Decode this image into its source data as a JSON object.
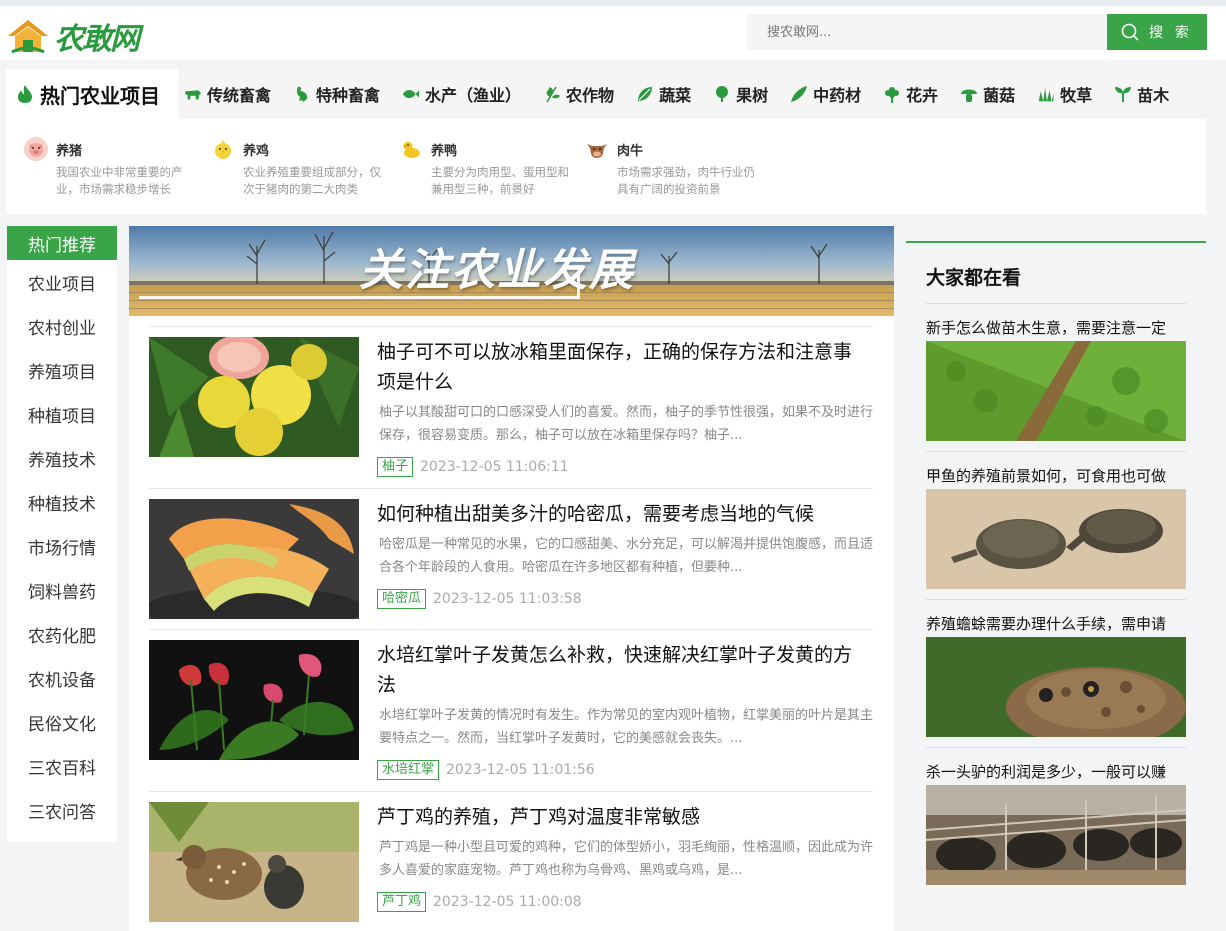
{
  "header": {
    "logo_text": "农敢网",
    "search_placeholder": "搜农敢网...",
    "search_button": "搜 索"
  },
  "categories": {
    "active": "热门农业项目",
    "items": [
      {
        "label": "传统畜禽",
        "icon": "cow-icon"
      },
      {
        "label": "特种畜禽",
        "icon": "rooster-icon"
      },
      {
        "label": "水产（渔业）",
        "icon": "fish-icon"
      },
      {
        "label": "农作物",
        "icon": "wheat-icon"
      },
      {
        "label": "蔬菜",
        "icon": "vegetable-icon"
      },
      {
        "label": "果树",
        "icon": "fruit-tree-icon"
      },
      {
        "label": "中药材",
        "icon": "herb-leaf-icon"
      },
      {
        "label": "花卉",
        "icon": "flower-icon"
      },
      {
        "label": "菌菇",
        "icon": "mushroom-icon"
      },
      {
        "label": "牧草",
        "icon": "grass-icon"
      },
      {
        "label": "苗木",
        "icon": "sapling-icon"
      }
    ]
  },
  "subpanel": [
    {
      "title": "养猪",
      "icon": "pig-icon",
      "desc": "我国农业中非常重要的产业，市场需求稳步增长"
    },
    {
      "title": "养鸡",
      "icon": "chick-icon",
      "desc": "农业养殖重要组成部分，仅次于猪肉的第二大肉类"
    },
    {
      "title": "养鸭",
      "icon": "duck-icon",
      "desc": "主要分为肉用型、蛋用型和兼用型三种，前景好"
    },
    {
      "title": "肉牛",
      "icon": "cattle-icon",
      "desc": "市场需求强劲，肉牛行业仍具有广阔的投资前景"
    }
  ],
  "leftnav": {
    "head": "热门推荐",
    "items": [
      "农业项目",
      "农村创业",
      "养殖项目",
      "种植项目",
      "养殖技术",
      "种植技术",
      "市场行情",
      "饲料兽药",
      "农药化肥",
      "农机设备",
      "民俗文化",
      "三农百科",
      "三农问答"
    ]
  },
  "banner": {
    "text": "关注农业发展"
  },
  "articles": [
    {
      "title": "柚子可不可以放冰箱里面保存，正确的保存方法和注意事项是什么",
      "desc": "柚子以其酸甜可口的口感深受人们的喜爱。然而，柚子的季节性很强，如果不及时进行保存，很容易变质。那么，柚子可以放在冰箱里保存吗？柚子...",
      "tag": "柚子",
      "date": "2023-12-05 11:06:11"
    },
    {
      "title": "如何种植出甜美多汁的哈密瓜，需要考虑当地的气候",
      "desc": "哈密瓜是一种常见的水果，它的口感甜美、水分充足，可以解渴并提供饱腹感，而且适合各个年龄段的人食用。哈密瓜在许多地区都有种植，但要种...",
      "tag": "哈密瓜",
      "date": "2023-12-05 11:03:58"
    },
    {
      "title": "水培红掌叶子发黄怎么补救，快速解决红掌叶子发黄的方法",
      "desc": "水培红掌叶子发黄的情况时有发生。作为常见的室内观叶植物，红掌美丽的叶片是其主要特点之一。然而，当红掌叶子发黄时，它的美感就会丧失。...",
      "tag": "水培红掌",
      "date": "2023-12-05 11:01:56"
    },
    {
      "title": "芦丁鸡的养殖，芦丁鸡对温度非常敏感",
      "desc": "芦丁鸡是一种小型且可爱的鸡种，它们的体型娇小，羽毛绚丽，性格温顺，因此成为许多人喜爱的家庭宠物。芦丁鸡也称为乌骨鸡、黑鸡或乌鸡，是...",
      "tag": "芦丁鸡",
      "date": "2023-12-05 11:00:08"
    }
  ],
  "right": {
    "title": "大家都在看",
    "items": [
      {
        "title": "新手怎么做苗木生意，需要注意一定"
      },
      {
        "title": "甲鱼的养殖前景如何，可食用也可做"
      },
      {
        "title": "养殖蟾蜍需要办理什么手续，需申请"
      },
      {
        "title": "杀一头驴的利润是多少，一般可以赚"
      }
    ]
  },
  "colors": {
    "accent": "#3aa548",
    "tag_border": "#3aa548"
  }
}
